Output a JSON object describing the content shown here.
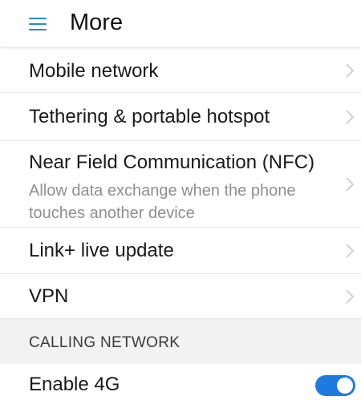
{
  "header": {
    "title": "More",
    "menu_icon": "hamburger-menu-icon"
  },
  "rows": [
    {
      "title": "Mobile network",
      "icon": "chevron-right-icon"
    },
    {
      "title": "Tethering & portable hotspot",
      "icon": "chevron-right-icon"
    },
    {
      "title": "Near Field Communication (NFC)",
      "subtitle": "Allow data exchange when the phone touches another device",
      "icon": "chevron-right-icon"
    },
    {
      "title": "Link+ live update",
      "icon": "chevron-right-icon"
    },
    {
      "title": "VPN",
      "icon": "chevron-right-icon"
    }
  ],
  "section": {
    "title": "CALLING NETWORK"
  },
  "toggle_row": {
    "title": "Enable 4G",
    "state": "on",
    "accent_color": "#1f7ae0"
  },
  "colors": {
    "accent": "#1e88e5",
    "section_bg": "#f2f2f2",
    "subtitle": "#8f8f8f"
  }
}
